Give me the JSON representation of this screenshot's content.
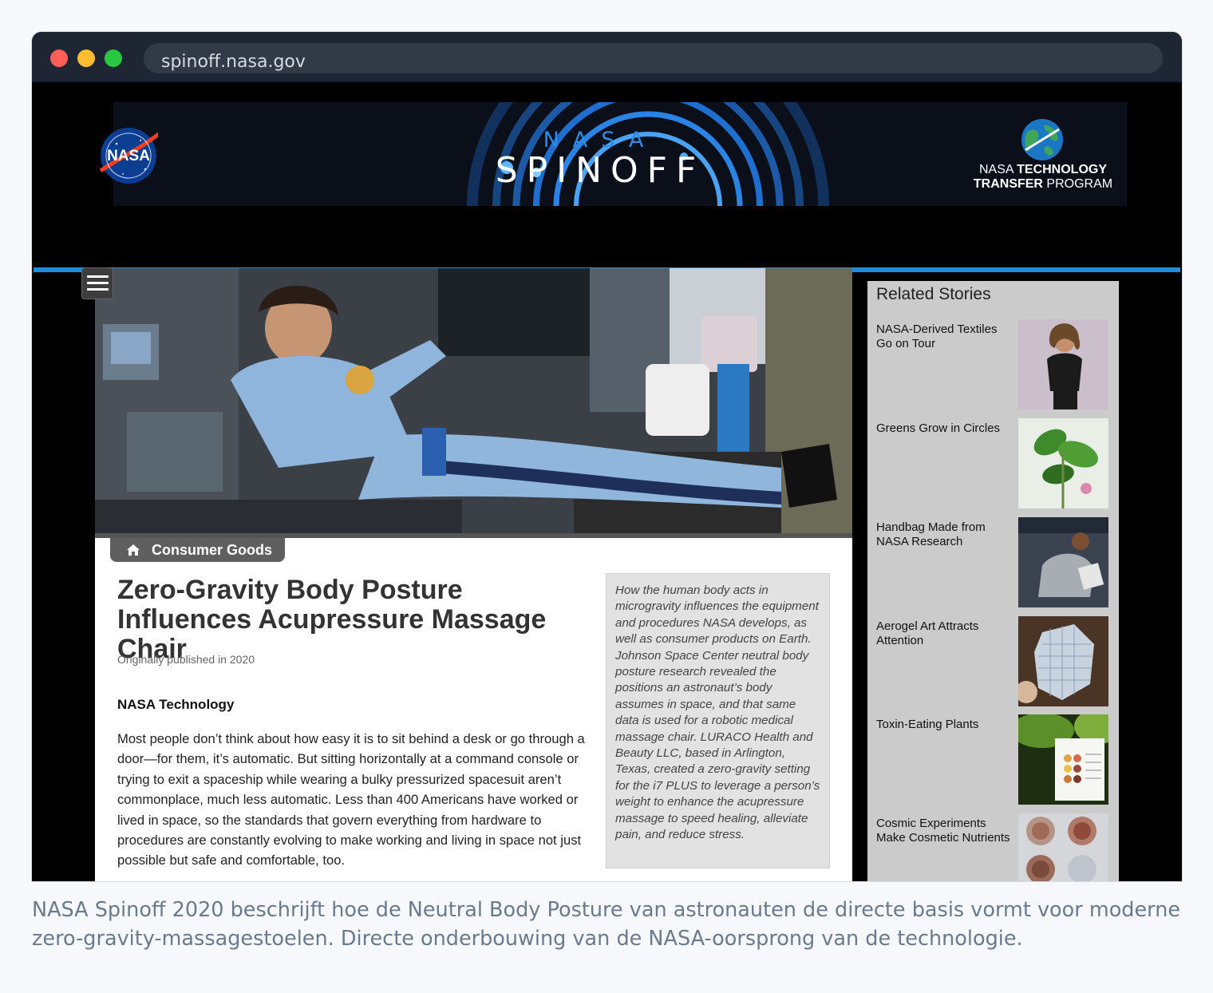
{
  "browser": {
    "url": "spinoff.nasa.gov"
  },
  "header": {
    "nasa_logo_text": "NASA",
    "spinoff_top": "NASA",
    "spinoff_title": "SPINOFF",
    "ttp_line1_light": "NASA ",
    "ttp_line1_bold": "TECHNOLOGY",
    "ttp_line2_bold": "TRANSFER",
    "ttp_line2_light": " PROGRAM"
  },
  "article": {
    "category": "Consumer Goods",
    "title": "Zero-Gravity Body Posture Influences Acupressure Massage Chair",
    "published": "Originally published in 2020",
    "section_heading": "NASA Technology",
    "body": "Most people don’t think about how easy it is to sit behind a desk or go through a door—for them, it’s automatic. But sitting horizontally at a command console or trying to exit a spaceship while wearing a bulky pressurized spacesuit aren’t commonplace, much less automatic. Less than 400 Americans have worked or lived in space, so the standards that govern everything from hardware to procedures are constantly evolving to make working and living in space not just possible but safe and comfortable, too.",
    "pullquote": "How the human body acts in microgravity influences the equipment and procedures NASA develops, as well as consumer products on Earth. Johnson Space Center neutral body posture research revealed the positions an astronaut’s body assumes in space, and that same data is used for a robotic medical massage chair. LURACO Health and Beauty LLC, based in Arlington, Texas, created a zero-gravity setting for the i7 PLUS to leverage a person’s weight to enhance the acupressure massage to speed healing, alleviate pain, and reduce stress."
  },
  "sidebar": {
    "heading": "Related Stories",
    "stories": [
      {
        "label": "NASA-Derived Textiles Go on Tour"
      },
      {
        "label": "Greens Grow in Circles"
      },
      {
        "label": "Handbag Made from NASA Research"
      },
      {
        "label": "Aerogel Art Attracts Attention"
      },
      {
        "label": "Toxin-Eating Plants"
      },
      {
        "label": "Cosmic Experiments Make Cosmetic Nutrients"
      }
    ]
  },
  "caption": "NASA Spinoff 2020 beschrijft hoe de Neutral Body Posture van astronauten de directe basis vormt voor moderne zero-gravity-massagestoelen. Directe onderbouwing van de NASA-oorsprong van de technologie.",
  "colors": {
    "accent_blue": "#1a8fe0",
    "sidebar_bg": "#cbcbcb",
    "category_tab": "#5f5f5f"
  }
}
